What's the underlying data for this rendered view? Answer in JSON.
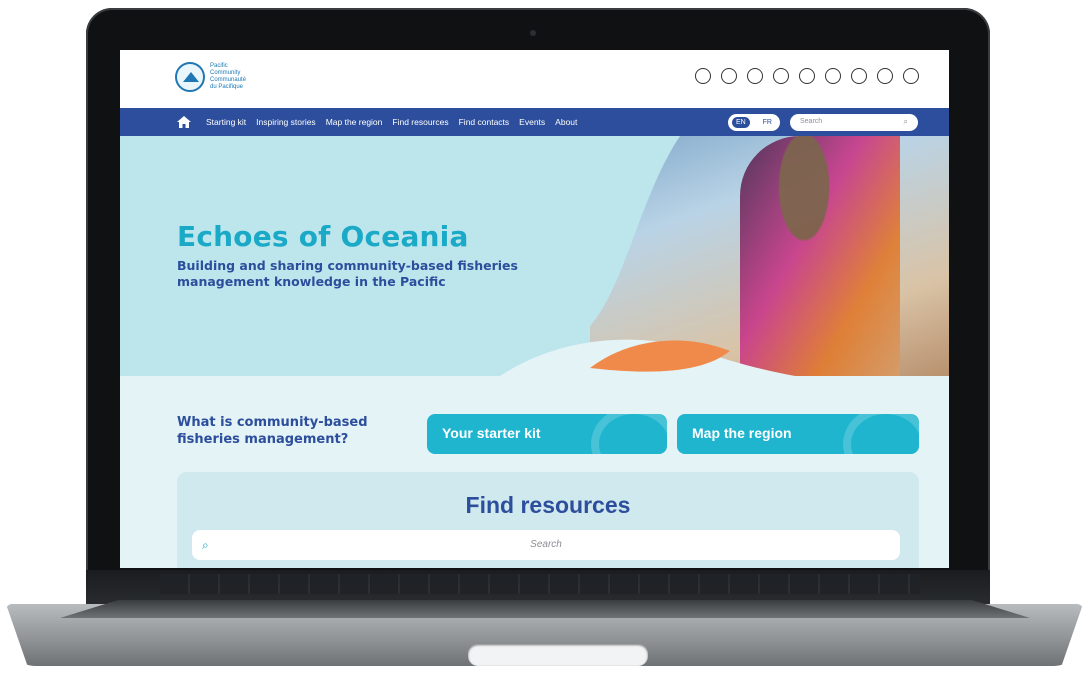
{
  "header": {
    "logo_lines": [
      "Pacific",
      "Community",
      "Communauté",
      "du Pacifique"
    ],
    "top_icons": [
      "person-icon",
      "fish-icon",
      "wave-icon",
      "globe-icon",
      "circle-icon",
      "figure-icon",
      "sun-icon",
      "tree-icon",
      "shell-icon"
    ]
  },
  "nav": {
    "items": [
      "Starting kit",
      "Inspiring stories",
      "Map the region",
      "Find resources",
      "Find contacts",
      "Events",
      "About"
    ],
    "lang_active": "EN",
    "lang_other": "FR",
    "search_placeholder": "Search"
  },
  "hero": {
    "title": "Echoes of Oceania",
    "subtitle": "Building and sharing community-based fisheries management knowledge in the Pacific"
  },
  "cta": {
    "question": "What is community-based fisheries management?",
    "starter_kit": "Your starter kit",
    "map_region": "Map the region"
  },
  "find": {
    "title": "Find resources",
    "search_placeholder": "Search"
  },
  "colors": {
    "nav_blue": "#2c4e9c",
    "accent_teal": "#1fb5cf",
    "hero_bg": "#bde6ec",
    "orange_accent": "#f08a4b"
  }
}
